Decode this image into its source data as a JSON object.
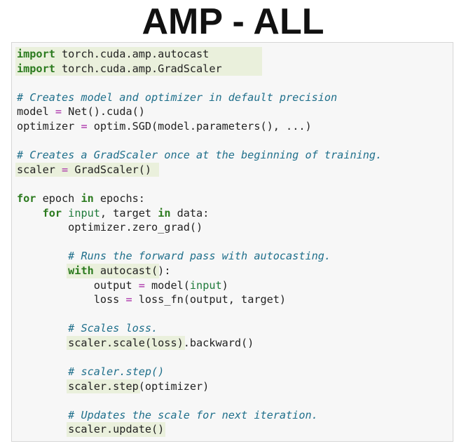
{
  "title": "AMP - ALL",
  "colors": {
    "keyword": "#2b7a1e",
    "comment": "#1f6f8b",
    "operator": "#a626a4",
    "builtin": "#1e7a3a",
    "text": "#222222",
    "highlight": "#eaf0dc",
    "panel_background": "#f7f7f7",
    "panel_border": "#d6d6d6"
  },
  "code": {
    "lines": [
      {
        "highlight": true,
        "hl_cols": 38,
        "tokens": [
          {
            "t": "kw",
            "v": "import"
          },
          {
            "t": "tx",
            "v": " torch.cuda.amp.autocast"
          }
        ]
      },
      {
        "highlight": true,
        "hl_cols": 38,
        "tokens": [
          {
            "t": "kw",
            "v": "import"
          },
          {
            "t": "tx",
            "v": " torch.cuda.amp.GradScaler"
          }
        ]
      },
      {
        "tokens": []
      },
      {
        "tokens": [
          {
            "t": "cm",
            "v": "# Creates model and optimizer in default precision"
          }
        ]
      },
      {
        "tokens": [
          {
            "t": "tx",
            "v": "model "
          },
          {
            "t": "op",
            "v": "="
          },
          {
            "t": "tx",
            "v": " Net().cuda()"
          }
        ]
      },
      {
        "tokens": [
          {
            "t": "tx",
            "v": "optimizer "
          },
          {
            "t": "op",
            "v": "="
          },
          {
            "t": "tx",
            "v": " optim.SGD(model.parameters(), ...)"
          }
        ]
      },
      {
        "tokens": []
      },
      {
        "tokens": [
          {
            "t": "cm",
            "v": "# Creates a GradScaler once at the beginning of training."
          }
        ]
      },
      {
        "highlight": true,
        "hl_cols": 22,
        "tokens": [
          {
            "t": "tx",
            "v": "scaler "
          },
          {
            "t": "op",
            "v": "="
          },
          {
            "t": "tx",
            "v": " GradScaler()"
          }
        ]
      },
      {
        "tokens": []
      },
      {
        "tokens": [
          {
            "t": "kw",
            "v": "for"
          },
          {
            "t": "tx",
            "v": " epoch "
          },
          {
            "t": "kw",
            "v": "in"
          },
          {
            "t": "tx",
            "v": " epochs:"
          }
        ]
      },
      {
        "tokens": [
          {
            "t": "tx",
            "v": "    "
          },
          {
            "t": "kw",
            "v": "for"
          },
          {
            "t": "tx",
            "v": " "
          },
          {
            "t": "bi",
            "v": "input"
          },
          {
            "t": "tx",
            "v": ", target "
          },
          {
            "t": "kw",
            "v": "in"
          },
          {
            "t": "tx",
            "v": " data:"
          }
        ]
      },
      {
        "tokens": [
          {
            "t": "tx",
            "v": "        optimizer.zero_grad()"
          }
        ]
      },
      {
        "tokens": []
      },
      {
        "tokens": [
          {
            "t": "tx",
            "v": "        "
          },
          {
            "t": "cm",
            "v": "# Runs the forward pass with autocasting."
          }
        ]
      },
      {
        "highlight": true,
        "hl_start": 8,
        "hl_cols": 14,
        "tokens": [
          {
            "t": "tx",
            "v": "        "
          },
          {
            "t": "kw",
            "v": "with"
          },
          {
            "t": "tx",
            "v": " autocast():"
          }
        ]
      },
      {
        "tokens": [
          {
            "t": "tx",
            "v": "            output "
          },
          {
            "t": "op",
            "v": "="
          },
          {
            "t": "tx",
            "v": " model("
          },
          {
            "t": "bi",
            "v": "input"
          },
          {
            "t": "tx",
            "v": ")"
          }
        ]
      },
      {
        "tokens": [
          {
            "t": "tx",
            "v": "            loss "
          },
          {
            "t": "op",
            "v": "="
          },
          {
            "t": "tx",
            "v": " loss_fn(output, target)"
          }
        ]
      },
      {
        "tokens": []
      },
      {
        "tokens": [
          {
            "t": "tx",
            "v": "        "
          },
          {
            "t": "cm",
            "v": "# Scales loss."
          }
        ]
      },
      {
        "highlight": true,
        "hl_start": 8,
        "hl_cols": 18,
        "tokens": [
          {
            "t": "tx",
            "v": "        scaler.scale(loss).backward()"
          }
        ]
      },
      {
        "tokens": []
      },
      {
        "tokens": [
          {
            "t": "tx",
            "v": "        "
          },
          {
            "t": "cm",
            "v": "# scaler.step()"
          }
        ]
      },
      {
        "highlight": true,
        "hl_start": 8,
        "hl_cols": 11,
        "tokens": [
          {
            "t": "tx",
            "v": "        scaler.step(optimizer)"
          }
        ]
      },
      {
        "tokens": []
      },
      {
        "tokens": [
          {
            "t": "tx",
            "v": "        "
          },
          {
            "t": "cm",
            "v": "# Updates the scale for next iteration."
          }
        ]
      },
      {
        "highlight": true,
        "hl_start": 8,
        "hl_cols": 15,
        "tokens": [
          {
            "t": "tx",
            "v": "        scaler.update()"
          }
        ]
      }
    ]
  }
}
